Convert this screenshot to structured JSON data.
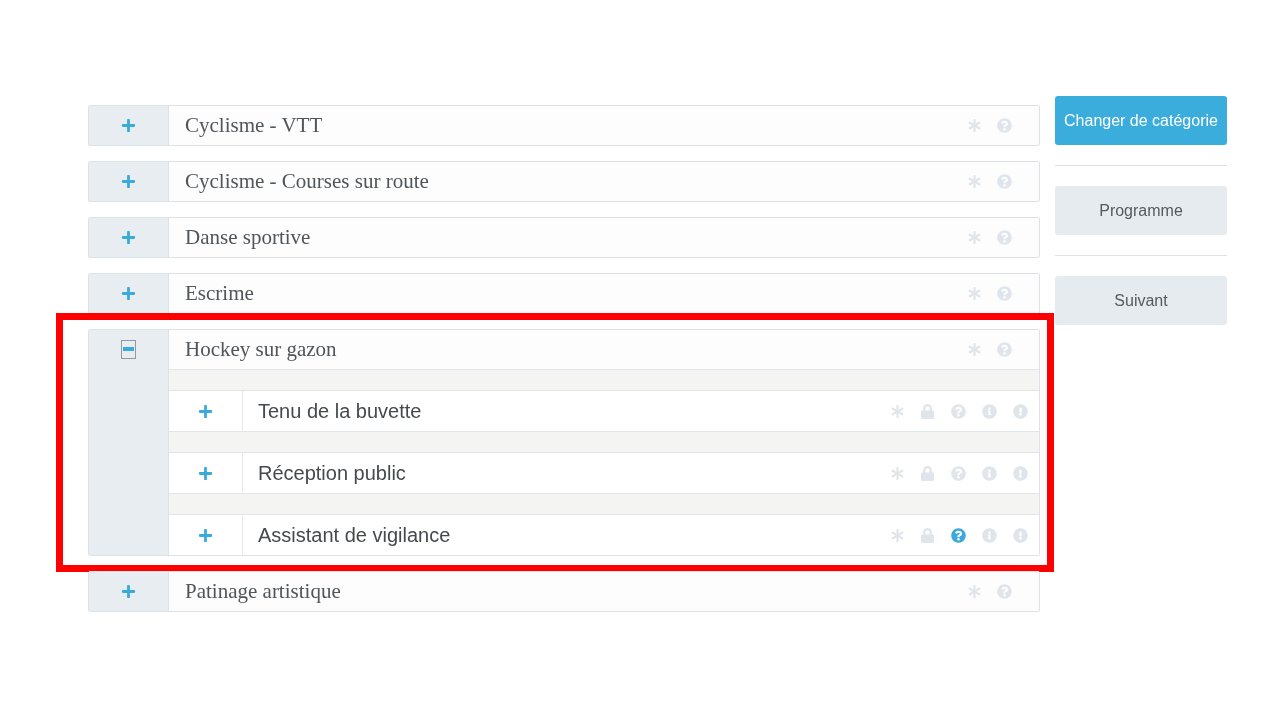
{
  "categories": [
    {
      "title": "Cyclisme - VTT",
      "expanded": false,
      "highlighted": false
    },
    {
      "title": "Cyclisme - Courses sur route",
      "expanded": false,
      "highlighted": false
    },
    {
      "title": "Danse sportive",
      "expanded": false,
      "highlighted": false
    },
    {
      "title": "Escrime",
      "expanded": false,
      "highlighted": false
    },
    {
      "title": "Hockey sur gazon",
      "expanded": true,
      "highlighted": true,
      "children": [
        {
          "title": "Tenu de la buvette",
          "expanded": false,
          "help_active": false
        },
        {
          "title": "Réception public",
          "expanded": false,
          "help_active": false
        },
        {
          "title": "Assistant de vigilance",
          "expanded": false,
          "help_active": true
        }
      ]
    },
    {
      "title": "Patinage artistique",
      "expanded": false,
      "highlighted": false
    }
  ],
  "buttons": [
    {
      "label": "Changer de catégorie",
      "kind": "primary"
    },
    {
      "label": "Programme",
      "kind": "secondary"
    },
    {
      "label": "Suivant",
      "kind": "secondary"
    }
  ]
}
